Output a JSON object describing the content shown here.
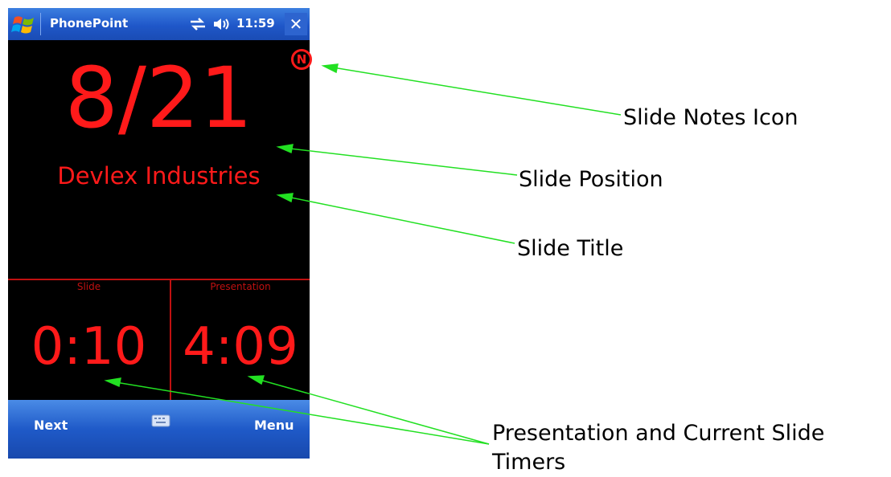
{
  "window": {
    "title": "PhonePoint",
    "time": "11:59",
    "close_label": "✕"
  },
  "slide": {
    "position": "8/21",
    "title": "Devlex Industries",
    "notes_icon_letter": "N"
  },
  "timers": {
    "slide_label": "Slide",
    "slide_value": "0:10",
    "presentation_label": "Presentation",
    "presentation_value": "4:09"
  },
  "softkeys": {
    "left": "Next",
    "right": "Menu"
  },
  "callouts": {
    "notes": "Slide Notes Icon",
    "position": "Slide Position",
    "title": "Slide Title",
    "timers_line1": "Presentation and Current Slide",
    "timers_line2": "Timers"
  },
  "colors": {
    "accent": "#ff1a1a",
    "arrow": "#22e022",
    "titlebar": "#1f57c9"
  },
  "icons": [
    "windows-start-icon",
    "connectivity-icon",
    "volume-icon",
    "close-icon",
    "notes-icon",
    "keyboard-icon"
  ]
}
